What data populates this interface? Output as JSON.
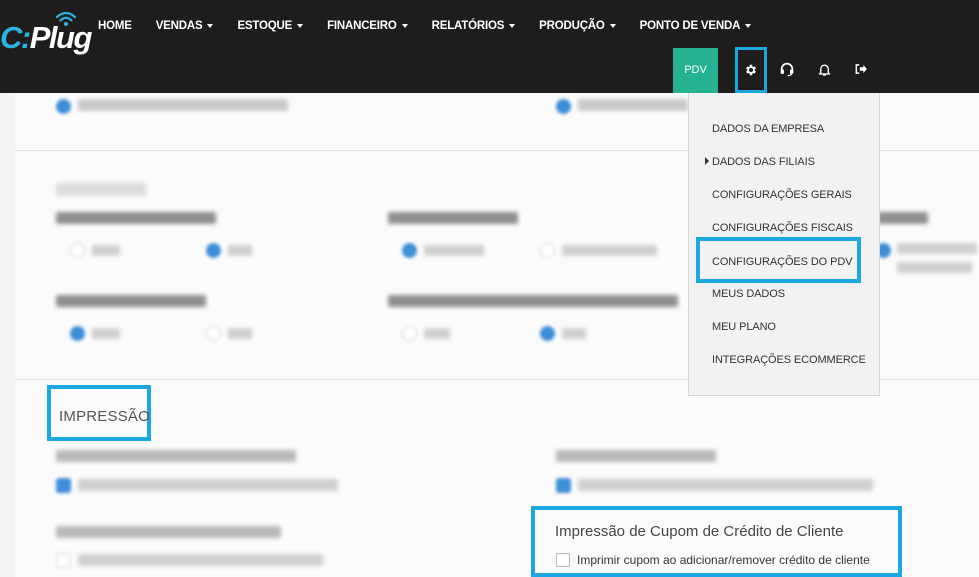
{
  "logo": {
    "text_c": "C",
    "text_rest": "Plug"
  },
  "nav": {
    "items": [
      {
        "label": "HOME",
        "has_caret": false
      },
      {
        "label": "VENDAS",
        "has_caret": true
      },
      {
        "label": "ESTOQUE",
        "has_caret": true
      },
      {
        "label": "FINANCEIRO",
        "has_caret": true
      },
      {
        "label": "RELATÓRIOS",
        "has_caret": true
      },
      {
        "label": "PRODUÇÃO",
        "has_caret": true
      },
      {
        "label": "PONTO DE VENDA",
        "has_caret": true
      }
    ]
  },
  "toolbar": {
    "pdv_label": "PDV",
    "icons": [
      "gear-icon",
      "headset-icon",
      "bell-icon",
      "logout-icon"
    ]
  },
  "settings_menu": {
    "items": [
      {
        "label": "DADOS DA EMPRESA"
      },
      {
        "label": "DADOS DAS FILIAIS",
        "has_submenu": true
      },
      {
        "label": "CONFIGURAÇÕES GERAIS"
      },
      {
        "label": "CONFIGURAÇÕES FISCAIS"
      },
      {
        "label": "CONFIGURAÇÕES DO PDV",
        "highlighted": true
      },
      {
        "label": "MEUS DADOS"
      },
      {
        "label": "MEU PLANO"
      },
      {
        "label": "INTEGRAÇÕES ECOMMERCE"
      }
    ]
  },
  "impressao": {
    "section_title": "IMPRESSÃO"
  },
  "credit_coupon": {
    "title": "Impressão de Cupom de Crédito de Cliente",
    "checkbox_label": "Imprimir cupom ao adicionar/remover crédito de cliente",
    "checked": false
  },
  "colors": {
    "topbar": "#1f1c1c",
    "accent_green": "#25b291",
    "highlight_blue": "#1ba7df",
    "radio_blue": "#3e8ed8"
  }
}
